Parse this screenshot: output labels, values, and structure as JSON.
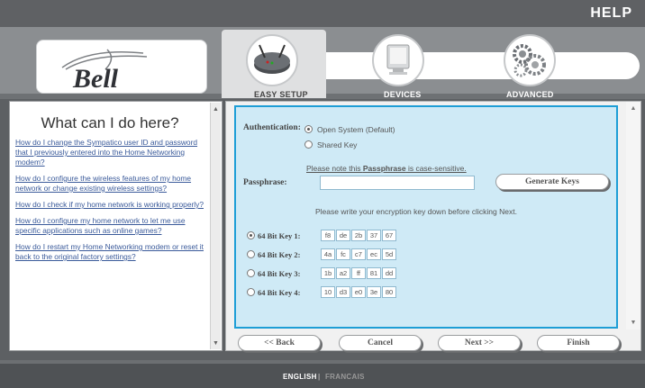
{
  "header": {
    "help_label": "HELP",
    "logo_text": "Bell"
  },
  "nav": {
    "tabs": [
      {
        "label": "EASY SETUP",
        "active": true,
        "icon": "router-icon"
      },
      {
        "label": "DEVICES",
        "active": false,
        "icon": "monitor-icon"
      },
      {
        "label": "ADVANCED",
        "active": false,
        "icon": "gears-icon"
      }
    ]
  },
  "help_panel": {
    "title": "What can I do here?",
    "links": [
      "How do I change the Sympatico user ID and password that I previously entered into the Home Networking modem?",
      "How do I configure the wireless features of my home network or change existing wireless settings?",
      "How do I check if my home network is working properly?",
      "How do I configure my home network to let me use specific applications such as online games?",
      "How do I restart my Home Networking modem or reset it back to the original factory settings?"
    ]
  },
  "form": {
    "auth_label": "Authentication:",
    "auth_options": [
      {
        "label": "Open System (Default)",
        "selected": true
      },
      {
        "label": "Shared Key",
        "selected": false
      }
    ],
    "note_prefix": "Please note this ",
    "note_bold": "Passphrase",
    "note_suffix": " is case-sensitive.",
    "passphrase_label": "Passphrase:",
    "passphrase_value": "",
    "generate_button": "Generate Keys",
    "instruction": "Please write your encryption key down before clicking Next.",
    "keys": [
      {
        "label": "64 Bit Key 1:",
        "selected": true,
        "bytes": [
          "f8",
          "de",
          "2b",
          "37",
          "67"
        ]
      },
      {
        "label": "64 Bit Key 2:",
        "selected": false,
        "bytes": [
          "4a",
          "fc",
          "c7",
          "ec",
          "5d"
        ]
      },
      {
        "label": "64 Bit Key 3:",
        "selected": false,
        "bytes": [
          "1b",
          "a2",
          "ff",
          "81",
          "dd"
        ]
      },
      {
        "label": "64 Bit Key 4:",
        "selected": false,
        "bytes": [
          "10",
          "d3",
          "e0",
          "3e",
          "80"
        ]
      }
    ]
  },
  "buttons": {
    "back": "<< Back",
    "cancel": "Cancel",
    "next": "Next >>",
    "finish": "Finish"
  },
  "footer": {
    "english": "ENGLISH",
    "separator": "|",
    "francais": "FRANCAIS"
  },
  "colors": {
    "accent_blue": "#1d9ed6",
    "panel_blue": "#cfeaf6",
    "link": "#3a5a9a"
  }
}
